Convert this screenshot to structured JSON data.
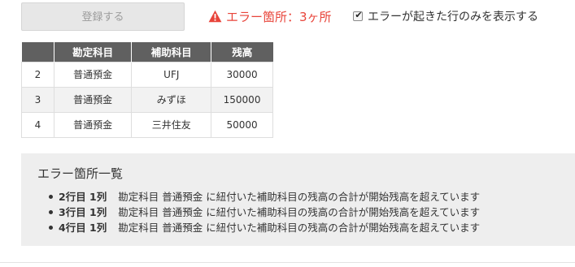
{
  "toolbar": {
    "register_label": "登録する"
  },
  "error_summary": {
    "text": "エラー箇所：3ヶ所",
    "color": "#e8443a",
    "icon": "warning-triangle-icon"
  },
  "filter": {
    "label": "エラーが起きた行のみを表示する",
    "checked": true
  },
  "table": {
    "headers": [
      "",
      "勘定科目",
      "補助科目",
      "残高"
    ],
    "rows": [
      [
        "2",
        "普通預金",
        "UFJ",
        "30000"
      ],
      [
        "3",
        "普通預金",
        "みずほ",
        "150000"
      ],
      [
        "4",
        "普通預金",
        "三井住友",
        "50000"
      ]
    ]
  },
  "error_list": {
    "title": "エラー箇所一覧",
    "items": [
      {
        "location": "2行目 1列",
        "message": "勘定科目 普通預金 に紐付いた補助科目の残高の合計が開始残高を超えています"
      },
      {
        "location": "3行目 1列",
        "message": "勘定科目 普通預金 に紐付いた補助科目の残高の合計が開始残高を超えています"
      },
      {
        "location": "4行目 1列",
        "message": "勘定科目 普通預金 に紐付いた補助科目の残高の合計が開始残高を超えています"
      }
    ]
  }
}
